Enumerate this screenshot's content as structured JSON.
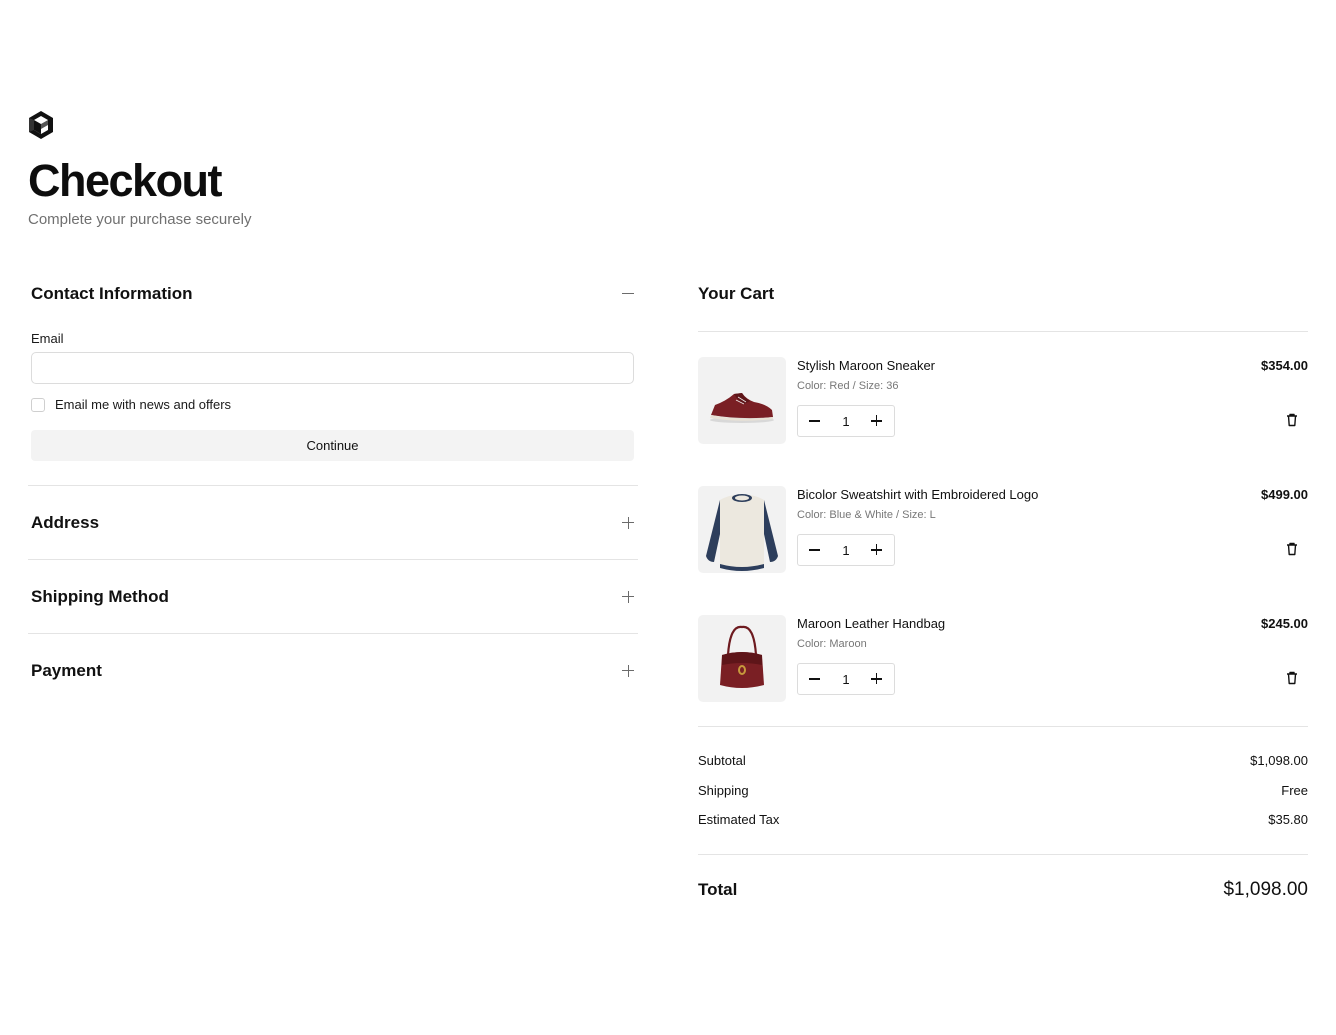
{
  "brand": {
    "logo_icon": "cube-logo-icon"
  },
  "header": {
    "title": "Checkout",
    "subtitle": "Complete your purchase securely"
  },
  "sections": {
    "contact": {
      "title": "Contact Information",
      "email_label": "Email",
      "email_value": "",
      "email_placeholder": "",
      "newsletter_label": "Email me with news and offers",
      "newsletter_checked": false,
      "continue_label": "Continue",
      "expanded_icon": "minus-icon"
    },
    "address": {
      "title": "Address",
      "icon": "plus-icon"
    },
    "shipping": {
      "title": "Shipping Method",
      "icon": "plus-icon"
    },
    "payment": {
      "title": "Payment",
      "icon": "plus-icon"
    }
  },
  "cart": {
    "title": "Your Cart",
    "items": [
      {
        "name": "Stylish Maroon Sneaker",
        "variant": "Color: Red / Size: 36",
        "price": "$354.00",
        "quantity": "1",
        "image_icon": "sneaker-image"
      },
      {
        "name": "Bicolor Sweatshirt with Embroidered Logo",
        "variant": "Color: Blue & White / Size: L",
        "price": "$499.00",
        "quantity": "1",
        "image_icon": "sweatshirt-image"
      },
      {
        "name": "Maroon Leather Handbag",
        "variant": "Color: Maroon",
        "price": "$245.00",
        "quantity": "1",
        "image_icon": "handbag-image"
      }
    ],
    "summary": {
      "subtotal_label": "Subtotal",
      "subtotal_value": "$1,098.00",
      "shipping_label": "Shipping",
      "shipping_value": "Free",
      "tax_label": "Estimated Tax",
      "tax_value": "$35.80",
      "total_label": "Total",
      "total_value": "$1,098.00"
    }
  },
  "colors": {
    "accent": "#111111",
    "muted": "#707070",
    "border": "#e4e4e4",
    "button_bg": "#f3f3f3",
    "maroon": "#7a1f24"
  }
}
